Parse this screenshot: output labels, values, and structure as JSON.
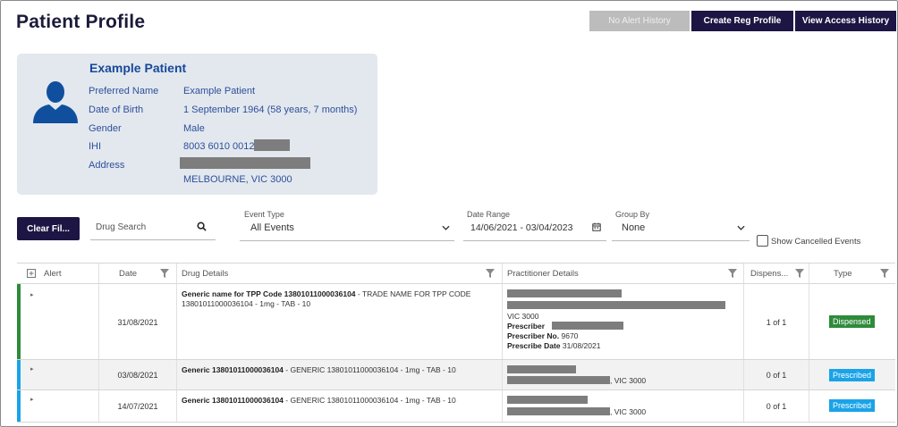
{
  "header": {
    "title": "Patient Profile",
    "no_alert_label": "No Alert History",
    "create_reg_label": "Create Reg Profile",
    "view_access_label": "View Access History"
  },
  "patient": {
    "name": "Example Patient",
    "fields": [
      {
        "label": "Preferred Name",
        "value": "Example Patient"
      },
      {
        "label": "Date of Birth",
        "value": "1 September 1964 (58 years, 7 months)"
      },
      {
        "label": "Gender",
        "value": "Male"
      },
      {
        "label": "IHI",
        "value": "8003 6010 0012"
      },
      {
        "label": "Address",
        "value": ""
      }
    ],
    "address_line2": "MELBOURNE, VIC 3000"
  },
  "filters": {
    "clear_label": "Clear Fil...",
    "drug_search_placeholder": "Drug Search",
    "event_type_label": "Event Type",
    "event_type_value": "All Events",
    "date_range_label": "Date Range",
    "date_range_value": "14/06/2021 - 03/04/2023",
    "group_by_label": "Group By",
    "group_by_value": "None",
    "show_cancelled_label": "Show Cancelled Events"
  },
  "table": {
    "columns": {
      "alert": "Alert",
      "date": "Date",
      "drug": "Drug Details",
      "practitioner": "Practitioner Details",
      "dispensed": "Dispens...",
      "type": "Type"
    },
    "rows": [
      {
        "date": "31/08/2021",
        "drug_bold": "Generic name for TPP Code 13801011000036104",
        "drug_rest": " - TRADE NAME FOR TPP CODE 13801011000036104 - 1mg - TAB - 10",
        "prac_state": "VIC 3000",
        "prescriber_label": "Prescriber",
        "prescriber_no_label": "Prescriber No.",
        "prescriber_no": "9670",
        "prescribe_date_label": "Prescribe Date",
        "prescribe_date": "31/08/2021",
        "dispensed": "1 of 1",
        "type": "Dispensed",
        "accent": "#2e8b3a"
      },
      {
        "date": "03/08/2021",
        "drug_bold": "Generic 13801011000036104",
        "drug_rest": " - GENERIC 13801011000036104 - 1mg - TAB - 10",
        "prac_state": ", VIC 3000",
        "dispensed": "0 of 1",
        "type": "Prescribed",
        "accent": "#1aa3e8"
      },
      {
        "date": "14/07/2021",
        "drug_bold": "Generic 13801011000036104",
        "drug_rest": " - GENERIC 13801011000036104 - 1mg - TAB - 10",
        "prac_state": ", VIC 3000",
        "dispensed": "0 of 1",
        "type": "Prescribed",
        "accent": "#1aa3e8"
      }
    ]
  },
  "icons": {
    "search": "search-icon",
    "calendar": "calendar-icon",
    "filter": "filter-icon",
    "expand_all": "expand-all-icon",
    "row_expand": "row-expand-icon",
    "avatar": "person-silhouette-icon"
  },
  "colors": {
    "primary": "#1d1543",
    "name_blue": "#17499a",
    "dispensed": "#2e8b3a",
    "prescribed": "#1aa3e8"
  }
}
